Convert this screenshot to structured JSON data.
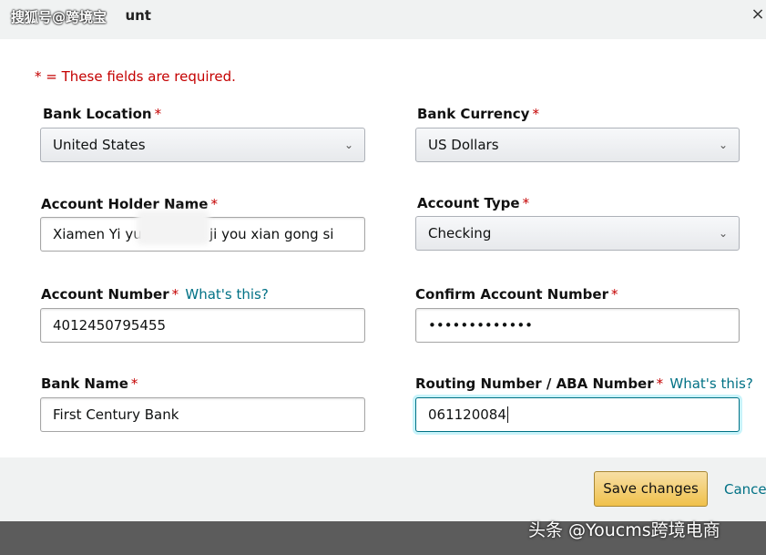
{
  "dialog": {
    "title": "unt",
    "close_glyph": "×"
  },
  "form": {
    "required_note": "* = These fields are required.",
    "bank_location": {
      "label": "Bank Location",
      "required": "*",
      "value": "United States"
    },
    "bank_currency": {
      "label": "Bank Currency",
      "required": "*",
      "value": "US Dollars"
    },
    "account_holder_name": {
      "label": "Account Holder Name",
      "required": "*",
      "value_start": "Xiamen Yi yu",
      "value_end": "ji you xian gong si"
    },
    "account_type": {
      "label": "Account Type",
      "required": "*",
      "value": "Checking"
    },
    "account_number": {
      "label": "Account Number",
      "required": "*",
      "help": "What's this?",
      "value": "4012450795455"
    },
    "confirm_account_number": {
      "label": "Confirm Account Number",
      "required": "*",
      "value": "•••••••••••••"
    },
    "bank_name": {
      "label": "Bank Name",
      "required": "*",
      "value": "First Century Bank"
    },
    "routing_number": {
      "label": "Routing Number / ABA Number",
      "required": "*",
      "help": "What's this?",
      "value": "061120084"
    }
  },
  "footer": {
    "save_label": "Save changes",
    "cancel_label": "Cancel"
  },
  "watermarks": {
    "top": "搜狐号@跨境宝",
    "bottom": "头条 @Youcms跨境电商"
  },
  "icons": {
    "select_chevron": "chevron-down-icon",
    "close": "close-icon"
  },
  "colors": {
    "required": "#c40000",
    "link": "#007185",
    "button": "#f0c14b"
  }
}
